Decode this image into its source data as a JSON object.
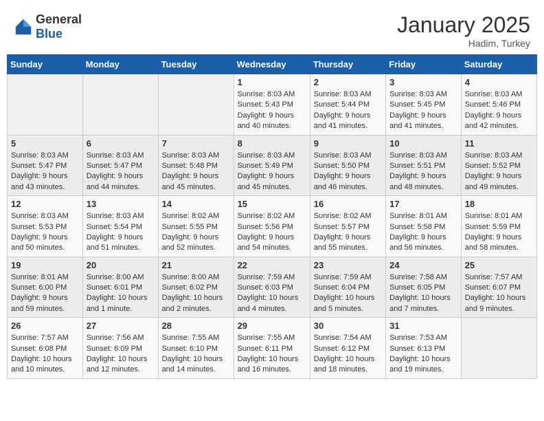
{
  "header": {
    "logo_general": "General",
    "logo_blue": "Blue",
    "month": "January 2025",
    "location": "Hadim, Turkey"
  },
  "weekdays": [
    "Sunday",
    "Monday",
    "Tuesday",
    "Wednesday",
    "Thursday",
    "Friday",
    "Saturday"
  ],
  "weeks": [
    [
      {
        "day": "",
        "content": ""
      },
      {
        "day": "",
        "content": ""
      },
      {
        "day": "",
        "content": ""
      },
      {
        "day": "1",
        "content": "Sunrise: 8:03 AM\nSunset: 5:43 PM\nDaylight: 9 hours\nand 40 minutes."
      },
      {
        "day": "2",
        "content": "Sunrise: 8:03 AM\nSunset: 5:44 PM\nDaylight: 9 hours\nand 41 minutes."
      },
      {
        "day": "3",
        "content": "Sunrise: 8:03 AM\nSunset: 5:45 PM\nDaylight: 9 hours\nand 41 minutes."
      },
      {
        "day": "4",
        "content": "Sunrise: 8:03 AM\nSunset: 5:46 PM\nDaylight: 9 hours\nand 42 minutes."
      }
    ],
    [
      {
        "day": "5",
        "content": "Sunrise: 8:03 AM\nSunset: 5:47 PM\nDaylight: 9 hours\nand 43 minutes."
      },
      {
        "day": "6",
        "content": "Sunrise: 8:03 AM\nSunset: 5:47 PM\nDaylight: 9 hours\nand 44 minutes."
      },
      {
        "day": "7",
        "content": "Sunrise: 8:03 AM\nSunset: 5:48 PM\nDaylight: 9 hours\nand 45 minutes."
      },
      {
        "day": "8",
        "content": "Sunrise: 8:03 AM\nSunset: 5:49 PM\nDaylight: 9 hours\nand 45 minutes."
      },
      {
        "day": "9",
        "content": "Sunrise: 8:03 AM\nSunset: 5:50 PM\nDaylight: 9 hours\nand 46 minutes."
      },
      {
        "day": "10",
        "content": "Sunrise: 8:03 AM\nSunset: 5:51 PM\nDaylight: 9 hours\nand 48 minutes."
      },
      {
        "day": "11",
        "content": "Sunrise: 8:03 AM\nSunset: 5:52 PM\nDaylight: 9 hours\nand 49 minutes."
      }
    ],
    [
      {
        "day": "12",
        "content": "Sunrise: 8:03 AM\nSunset: 5:53 PM\nDaylight: 9 hours\nand 50 minutes."
      },
      {
        "day": "13",
        "content": "Sunrise: 8:03 AM\nSunset: 5:54 PM\nDaylight: 9 hours\nand 51 minutes."
      },
      {
        "day": "14",
        "content": "Sunrise: 8:02 AM\nSunset: 5:55 PM\nDaylight: 9 hours\nand 52 minutes."
      },
      {
        "day": "15",
        "content": "Sunrise: 8:02 AM\nSunset: 5:56 PM\nDaylight: 9 hours\nand 54 minutes."
      },
      {
        "day": "16",
        "content": "Sunrise: 8:02 AM\nSunset: 5:57 PM\nDaylight: 9 hours\nand 55 minutes."
      },
      {
        "day": "17",
        "content": "Sunrise: 8:01 AM\nSunset: 5:58 PM\nDaylight: 9 hours\nand 56 minutes."
      },
      {
        "day": "18",
        "content": "Sunrise: 8:01 AM\nSunset: 5:59 PM\nDaylight: 9 hours\nand 58 minutes."
      }
    ],
    [
      {
        "day": "19",
        "content": "Sunrise: 8:01 AM\nSunset: 6:00 PM\nDaylight: 9 hours\nand 59 minutes."
      },
      {
        "day": "20",
        "content": "Sunrise: 8:00 AM\nSunset: 6:01 PM\nDaylight: 10 hours\nand 1 minute."
      },
      {
        "day": "21",
        "content": "Sunrise: 8:00 AM\nSunset: 6:02 PM\nDaylight: 10 hours\nand 2 minutes."
      },
      {
        "day": "22",
        "content": "Sunrise: 7:59 AM\nSunset: 6:03 PM\nDaylight: 10 hours\nand 4 minutes."
      },
      {
        "day": "23",
        "content": "Sunrise: 7:59 AM\nSunset: 6:04 PM\nDaylight: 10 hours\nand 5 minutes."
      },
      {
        "day": "24",
        "content": "Sunrise: 7:58 AM\nSunset: 6:05 PM\nDaylight: 10 hours\nand 7 minutes."
      },
      {
        "day": "25",
        "content": "Sunrise: 7:57 AM\nSunset: 6:07 PM\nDaylight: 10 hours\nand 9 minutes."
      }
    ],
    [
      {
        "day": "26",
        "content": "Sunrise: 7:57 AM\nSunset: 6:08 PM\nDaylight: 10 hours\nand 10 minutes."
      },
      {
        "day": "27",
        "content": "Sunrise: 7:56 AM\nSunset: 6:09 PM\nDaylight: 10 hours\nand 12 minutes."
      },
      {
        "day": "28",
        "content": "Sunrise: 7:55 AM\nSunset: 6:10 PM\nDaylight: 10 hours\nand 14 minutes."
      },
      {
        "day": "29",
        "content": "Sunrise: 7:55 AM\nSunset: 6:11 PM\nDaylight: 10 hours\nand 16 minutes."
      },
      {
        "day": "30",
        "content": "Sunrise: 7:54 AM\nSunset: 6:12 PM\nDaylight: 10 hours\nand 18 minutes."
      },
      {
        "day": "31",
        "content": "Sunrise: 7:53 AM\nSunset: 6:13 PM\nDaylight: 10 hours\nand 19 minutes."
      },
      {
        "day": "",
        "content": ""
      }
    ]
  ]
}
